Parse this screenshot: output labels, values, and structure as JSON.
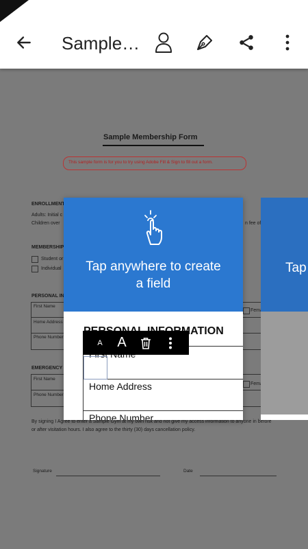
{
  "app_bar": {
    "title": "Sample…",
    "back_icon": "arrow-left-icon",
    "actions": [
      "person-icon",
      "pen-nib-icon",
      "share-icon",
      "more-vertical-icon"
    ]
  },
  "document": {
    "form_title": "Sample Membership Form",
    "notice": "This sample form is for you to try using Adobe Fill & Sign to fill out a form.",
    "enrollment_heading": "ENROLLMENT",
    "enrollment_line1": "Adults: Initial c",
    "enrollment_line2": "Children over",
    "enrollment_tail": "n fee of",
    "membership_heading": "MEMBERSHIP",
    "membership_option1": "Student or",
    "membership_option2": "Individual",
    "personal_heading": "PERSONAL IN",
    "personal_first_name": "First Name",
    "personal_home_address": "Home Address",
    "personal_phone": "Phone Number",
    "female_label_1": "Fema",
    "emergency_heading": "EMERGENCY",
    "emergency_first_name": "First Name",
    "emergency_phone": "Phone Number",
    "female_label_2": "Fema",
    "agreement_line1": "By signing I Agree to enter a Sample Gym at my own risk and not give my access information to anyone in before",
    "agreement_line2": "or after visitation hours. I also agree to the thirty (30) days cancellation policy.",
    "signature_label": "Signature",
    "date_label": "Date"
  },
  "tutorial_card": {
    "icon": "tap-hand-icon",
    "message_line1": "Tap anywhere to create",
    "message_line2": "a field",
    "preview_heading": "PERSONAL INFORMATION",
    "preview_field1": "First Name",
    "preview_field2": "Home Address",
    "preview_field3": "Phone Number"
  },
  "next_card": {
    "message": "Tap"
  },
  "field_toolbar": {
    "small_text_label": "A",
    "large_text_label": "A",
    "delete_icon": "trash-icon",
    "more_icon": "more-vertical-icon"
  }
}
